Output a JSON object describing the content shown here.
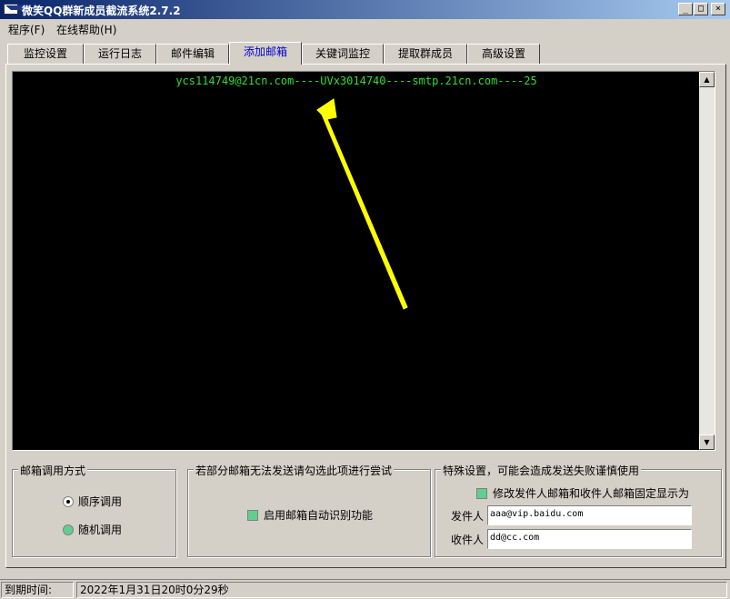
{
  "window": {
    "title": "微笑QQ群新成员截流系统2.7.2",
    "controls": {
      "minimize": "_",
      "maximize": "□",
      "close": "×"
    }
  },
  "menu": [
    {
      "label": "程序(F)"
    },
    {
      "label": "在线帮助(H)"
    }
  ],
  "tabs": [
    {
      "label": "监控设置"
    },
    {
      "label": "运行日志"
    },
    {
      "label": "邮件编辑"
    },
    {
      "label": "添加邮箱",
      "active": true
    },
    {
      "label": "关键词监控"
    },
    {
      "label": "提取群成员"
    },
    {
      "label": "高级设置"
    }
  ],
  "console": {
    "lines": [
      "ycs114749@21cn.com----UVx3014740----smtp.21cn.com----25"
    ],
    "text_color": "#33dd33",
    "background": "#000000",
    "annotation_arrow_color": "#ffff00"
  },
  "mailbox_mode": {
    "title": "邮箱调用方式",
    "options": [
      {
        "label": "顺序调用",
        "checked": true
      },
      {
        "label": "随机调用",
        "checked": false
      }
    ]
  },
  "auto_detect": {
    "title": "若部分邮箱无法发送请勾选此项进行尝试",
    "checkbox_label": "启用邮箱自动识别功能"
  },
  "special": {
    "title": "特殊设置，可能会造成发送失败谨慎使用",
    "checkbox_label": "修改发件人邮箱和收件人邮箱固定显示为",
    "sender_label": "发件人",
    "sender_value": "aaa@vip.baidu.com",
    "recipient_label": "收件人",
    "recipient_value": "dd@cc.com"
  },
  "status": {
    "label": "到期时间:",
    "value": "2022年1月31日20时0分29秒"
  }
}
